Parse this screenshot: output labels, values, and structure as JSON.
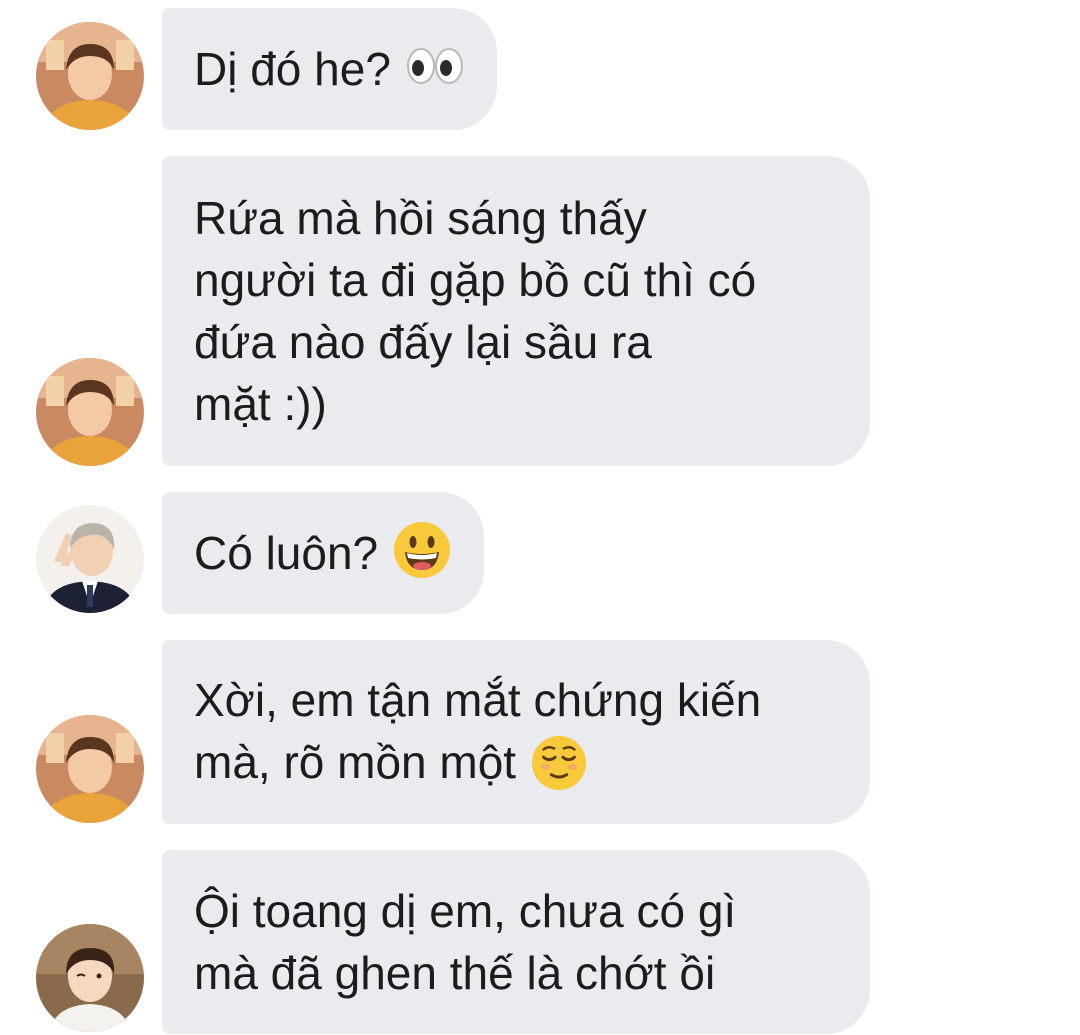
{
  "messages": [
    {
      "sender": "avatar-taehyung",
      "text": "Dị đó he?",
      "emoji": "eyes-emoji"
    },
    {
      "sender": "avatar-taehyung",
      "text": "Rứa mà hồi sáng thấy\nngười ta đi gặp bồ cũ thì có\nđứa nào đấy lại sầu ra\nmặt :))",
      "emoji": ""
    },
    {
      "sender": "avatar-namjoon",
      "text": "Có luôn?",
      "emoji": "grinning-face-emoji"
    },
    {
      "sender": "avatar-taehyung",
      "text": "Xời, em tận mắt chứng kiến\nmà, rõ mồn một",
      "emoji": "relieved-face-emoji"
    },
    {
      "sender": "avatar-seokjin",
      "text": "Ội toang dị em, chưa có gì\nmà đã ghen thế là chớt ồi",
      "emoji": ""
    }
  ],
  "colors": {
    "bubble": "#e9ebef",
    "text": "#1c1c1c",
    "background": "#ffffff"
  }
}
